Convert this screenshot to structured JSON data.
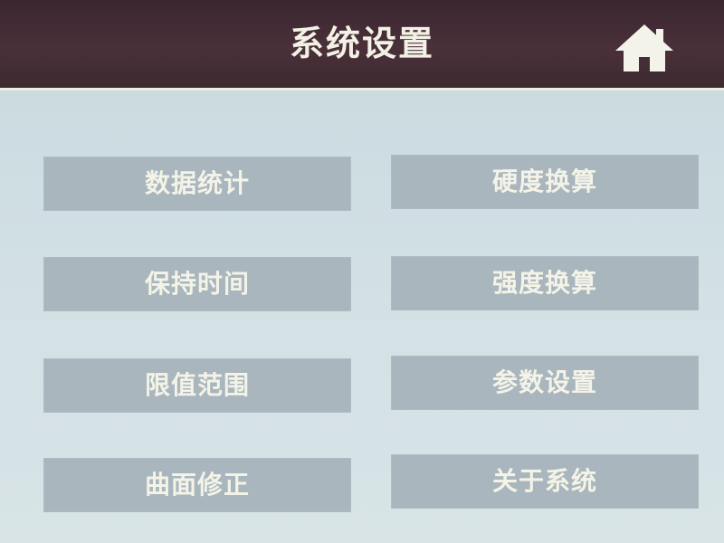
{
  "header": {
    "title": "系统设置",
    "home_icon": "home-icon"
  },
  "menu": {
    "items": [
      {
        "label": "数据统计"
      },
      {
        "label": "硬度换算"
      },
      {
        "label": "保持时间"
      },
      {
        "label": "强度换算"
      },
      {
        "label": "限值范围"
      },
      {
        "label": "参数设置"
      },
      {
        "label": "曲面修正"
      },
      {
        "label": "关于系统"
      }
    ]
  },
  "colors": {
    "header_bg": "#3f2a33",
    "body_bg": "#cfdfe4",
    "button_bg": "#a9b6bd",
    "button_text": "#f4f3e8"
  }
}
